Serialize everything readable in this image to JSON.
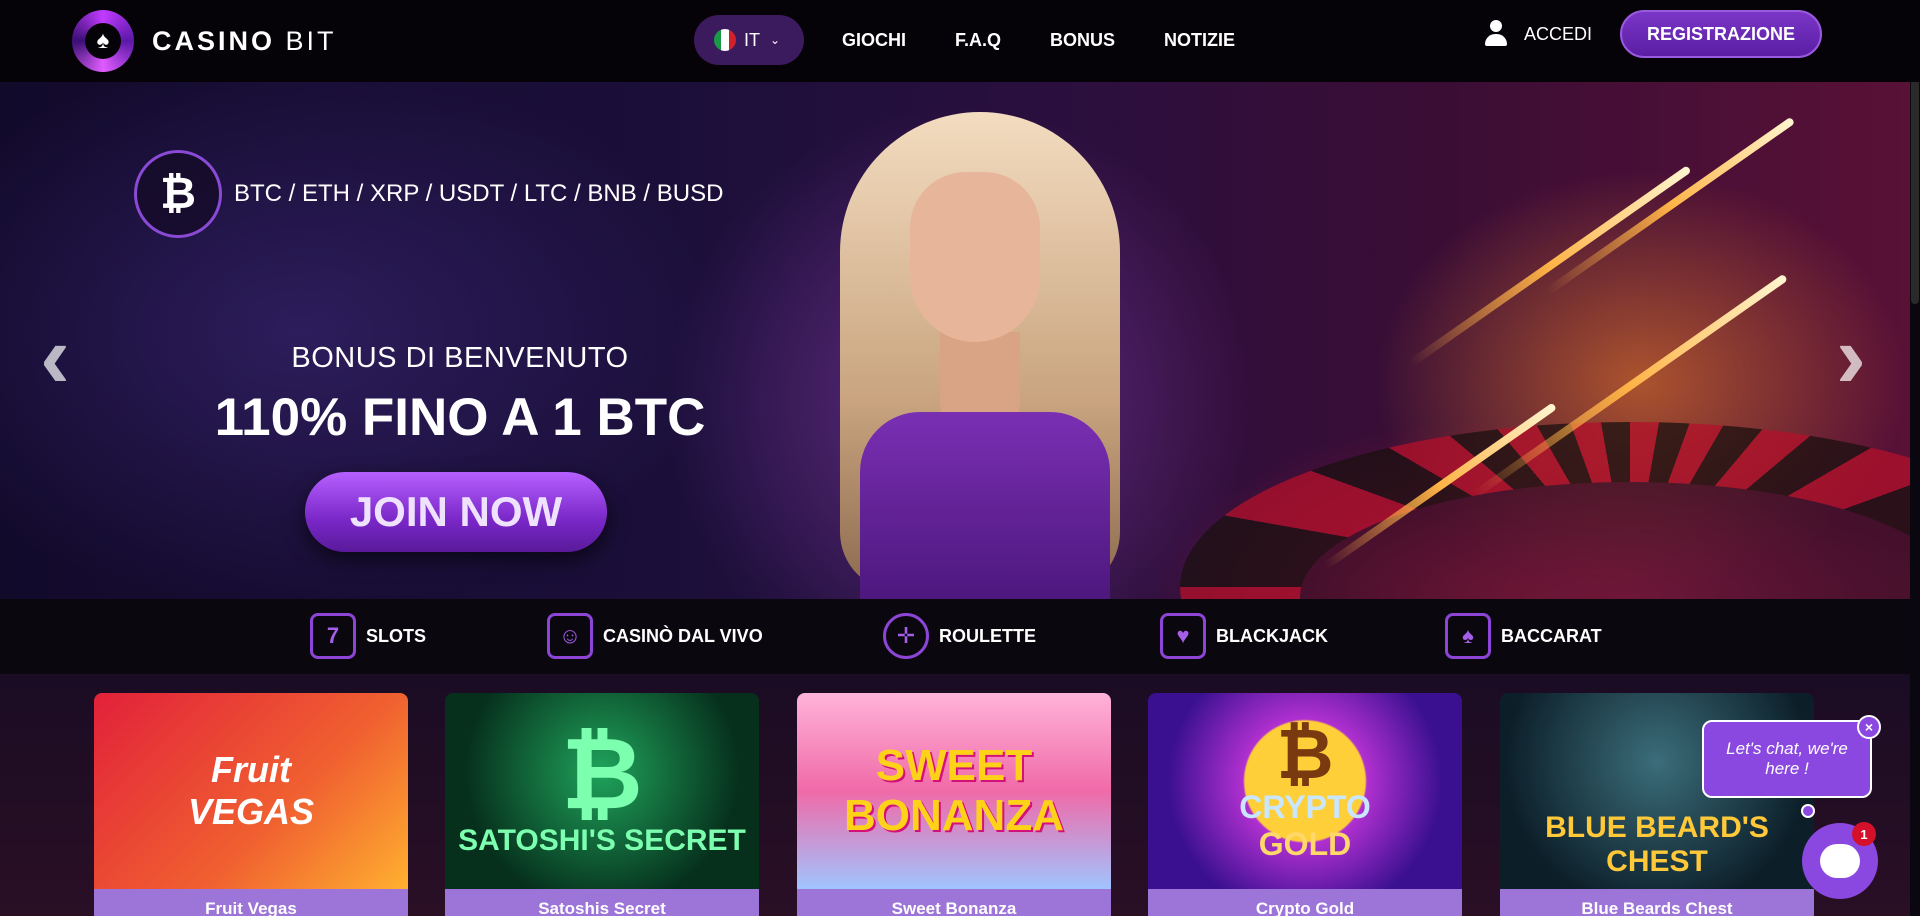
{
  "header": {
    "logo_main": "CASINO",
    "logo_light": "BIT",
    "language": "IT",
    "nav": [
      "GIOCHI",
      "F.A.Q",
      "BONUS",
      "NOTIZIE"
    ],
    "login": "ACCEDI",
    "register": "REGISTRAZIONE"
  },
  "hero": {
    "btc_symbol": "₿",
    "cryptos": "BTC / ETH / XRP / USDT / LTC / BNB / BUSD",
    "bonus_title": "BONUS DI BENVENUTO",
    "bonus_amount": "110% FINO A 1 BTC",
    "cta": "JOIN NOW",
    "prev": "‹",
    "next": "›"
  },
  "categories": [
    {
      "label": "SLOTS",
      "icon": "slot-machine-icon"
    },
    {
      "label": "CASINÒ DAL VIVO",
      "icon": "dealer-icon"
    },
    {
      "label": "ROULETTE",
      "icon": "roulette-icon"
    },
    {
      "label": "BLACKJACK",
      "icon": "blackjack-icon"
    },
    {
      "label": "BACCARAT",
      "icon": "baccarat-icon"
    }
  ],
  "games": [
    {
      "name": "Fruit Vegas",
      "art": "Fruit\nVEGAS",
      "color": "#e2213a"
    },
    {
      "name": "Satoshis Secret",
      "art": "SATOSHI'S SECRET",
      "color": "#0b6a3a"
    },
    {
      "name": "Sweet Bonanza",
      "art": "SWEET BONANZA",
      "color": "#f06aa8"
    },
    {
      "name": "Crypto Gold",
      "art": "CRYPTO GOLD",
      "color": "#4a1fa0"
    },
    {
      "name": "Blue Beards Chest",
      "art": "BLUE BEARD'S CHEST",
      "color": "#1d3b4a"
    }
  ],
  "chat": {
    "bubble": "Let's chat, we're here !",
    "close": "×",
    "badge": "1"
  }
}
